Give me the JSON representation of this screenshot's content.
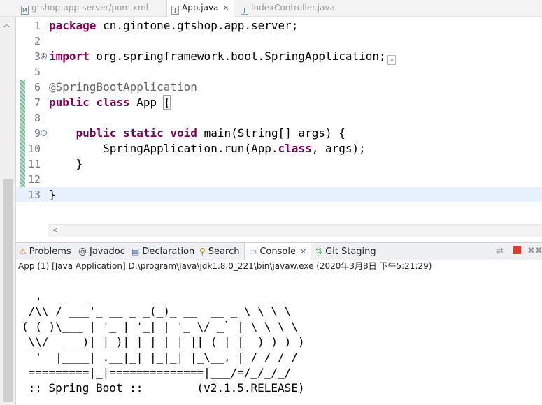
{
  "editor_tabs": [
    {
      "icon": "M",
      "label": "gtshop-app-server/pom.xml",
      "active": false
    },
    {
      "icon": "J",
      "label": "App.java",
      "active": true,
      "close": "✕"
    },
    {
      "icon": "J",
      "label": "IndexController.java",
      "active": false
    }
  ],
  "editor": {
    "lines": [
      {
        "num": "1",
        "tokens": [
          {
            "t": "package",
            "c": "kw"
          },
          {
            "t": " cn.gintone.gtshop.app.server;"
          }
        ]
      },
      {
        "num": "2",
        "tokens": []
      },
      {
        "num": "3",
        "fold": "+",
        "collapsed": true,
        "tokens": [
          {
            "t": "import",
            "c": "kw"
          },
          {
            "t": " org.springframework.boot.SpringApplication;"
          }
        ]
      },
      {
        "num": "5",
        "tokens": []
      },
      {
        "num": "6",
        "changed": true,
        "tokens": [
          {
            "t": "@SpringBootApplication",
            "c": "ann"
          }
        ]
      },
      {
        "num": "7",
        "changed": true,
        "tokens": [
          {
            "t": "public",
            "c": "kw"
          },
          {
            "t": " "
          },
          {
            "t": "class",
            "c": "kw"
          },
          {
            "t": " App "
          },
          {
            "t": "{",
            "c": "brace-box"
          }
        ]
      },
      {
        "num": "8",
        "changed": true,
        "tokens": []
      },
      {
        "num": "9",
        "fold": "−",
        "changed": true,
        "tokens": [
          {
            "t": "    "
          },
          {
            "t": "public",
            "c": "kw"
          },
          {
            "t": " "
          },
          {
            "t": "static",
            "c": "kw"
          },
          {
            "t": " "
          },
          {
            "t": "void",
            "c": "kw"
          },
          {
            "t": " main(String[] args) {"
          }
        ]
      },
      {
        "num": "10",
        "changed": true,
        "tokens": [
          {
            "t": "        SpringApplication.run(App."
          },
          {
            "t": "class",
            "c": "kw"
          },
          {
            "t": ", args);"
          }
        ]
      },
      {
        "num": "11",
        "changed": true,
        "tokens": [
          {
            "t": "    }"
          }
        ]
      },
      {
        "num": "12",
        "changed": true,
        "tokens": []
      },
      {
        "num": "13",
        "changed": true,
        "current": true,
        "tokens": [
          {
            "t": "}"
          }
        ]
      }
    ],
    "hscroll_arrow": "<"
  },
  "panel": {
    "tabs": [
      {
        "icon": "⚠",
        "icon_name": "problems-icon",
        "label": "Problems",
        "active": false
      },
      {
        "icon": "@",
        "icon_name": "javadoc-icon",
        "label": "Javadoc",
        "active": false
      },
      {
        "icon": "▤",
        "icon_name": "declaration-icon",
        "label": "Declaration",
        "active": false
      },
      {
        "icon": "⚲",
        "icon_name": "search-icon",
        "label": "Search",
        "active": false
      },
      {
        "icon": "▭",
        "icon_name": "console-icon",
        "label": "Console",
        "active": true,
        "close": "✕"
      },
      {
        "icon": "⇅",
        "icon_name": "git-staging-icon",
        "label": "Git Staging",
        "active": false
      }
    ],
    "colors": {
      "stop": "#e03c31",
      "remove": "#9a9a9a"
    }
  },
  "console": {
    "header": "App (1) [Java Application] D:\\program\\Java\\jdk1.8.0_221\\bin\\javaw.exe (2020年3月8日 下午5:21:29)",
    "output": "  .   ____          _            __ _ _\n /\\\\ / ___'_ __ _ _(_)_ __  __ _ \\ \\ \\ \\\n( ( )\\___ | '_ | '_| | '_ \\/ _` | \\ \\ \\ \\\n \\\\/  ___)| |_)| | | | | || (_| |  ) ) ) )\n  '  |____| .__|_| |_|_| |_\\__, | / / / /\n =========|_|==============|___/=/_/_/_/\n :: Spring Boot ::        (v2.1.5.RELEASE)"
  }
}
